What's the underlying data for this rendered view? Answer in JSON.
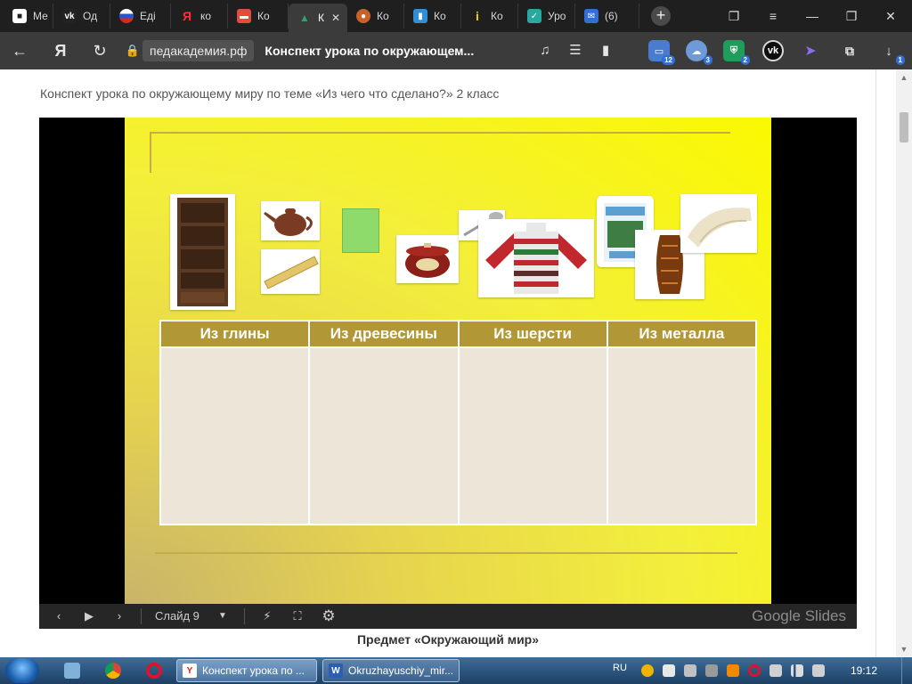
{
  "browser": {
    "tabs": [
      {
        "label": "Ме",
        "icon": "chat-icon",
        "color": "#ffffff"
      },
      {
        "label": "Од",
        "icon": "vk-icon",
        "color": "#0077ff"
      },
      {
        "label": "Еді",
        "icon": "flag-icon",
        "color": "#d52b1e"
      },
      {
        "label": "ко",
        "icon": "yandex-icon",
        "color": "#ff3333"
      },
      {
        "label": "Ко",
        "icon": "folder-icon",
        "color": "#e54b3c"
      },
      {
        "label": "К",
        "icon": "pedakademia-icon",
        "color": "#2aa36b",
        "active": true
      },
      {
        "label": "Ко",
        "icon": "doll-icon",
        "color": "#c8622b"
      },
      {
        "label": "Ко",
        "icon": "book-icon",
        "color": "#2f8fd8"
      },
      {
        "label": "Ко",
        "icon": "info-icon",
        "color": "#f5d200"
      },
      {
        "label": "Уро",
        "icon": "check-icon",
        "color": "#2aa8a0"
      },
      {
        "label": "(6)",
        "icon": "mail-icon",
        "color": "#2f6fd6"
      }
    ],
    "address": {
      "domain": "педакадемия.рф",
      "title": "Конспект урока по окружающем..."
    },
    "extensions": [
      {
        "name": "cards-icon",
        "badge": "12",
        "color": "#4a7bd0"
      },
      {
        "name": "cloud-icon",
        "badge": "3",
        "color": "#6f9ad8"
      },
      {
        "name": "shield-icon",
        "badge": "2",
        "color": "#1e9e5a"
      },
      {
        "name": "vk-icon",
        "badge": "",
        "color": "#0077ff"
      },
      {
        "name": "cursor-icon",
        "badge": "",
        "color": "#6a4be0"
      },
      {
        "name": "puzzle-icon",
        "badge": "",
        "color": "#8a8a8a"
      },
      {
        "name": "download-icon",
        "badge": "1",
        "color": "#8a8a8a"
      }
    ]
  },
  "page": {
    "article_title": "Конспект урока по окружающему миру по теме «Из чего что сделано?» 2 класс",
    "subject_heading": "Предмет «Окружающий  мир»"
  },
  "slide": {
    "items": [
      {
        "name": "bookcase-image"
      },
      {
        "name": "teapot-image"
      },
      {
        "name": "ruler-image"
      },
      {
        "name": "green-book-image"
      },
      {
        "name": "pot-image"
      },
      {
        "name": "spoon-image"
      },
      {
        "name": "sweater-image"
      },
      {
        "name": "textbook-image"
      },
      {
        "name": "vase-image"
      },
      {
        "name": "scarf-image"
      }
    ],
    "table": {
      "headers": [
        "Из глины",
        "Из древесины",
        "Из шерсти",
        "Из металла"
      ],
      "header_color": "#b19735",
      "cell_color": "#ece5d8"
    }
  },
  "slides_toolbar": {
    "slide_label": "Слайд 9",
    "brand": "Google Slides"
  },
  "taskbar": {
    "items": [
      {
        "label": "Конспект урока по ...",
        "icon": "yandex-icon"
      },
      {
        "label": "Okruzhayuschiy_mir...",
        "icon": "word-icon"
      }
    ],
    "lang": "RU",
    "clock": "19:12"
  }
}
